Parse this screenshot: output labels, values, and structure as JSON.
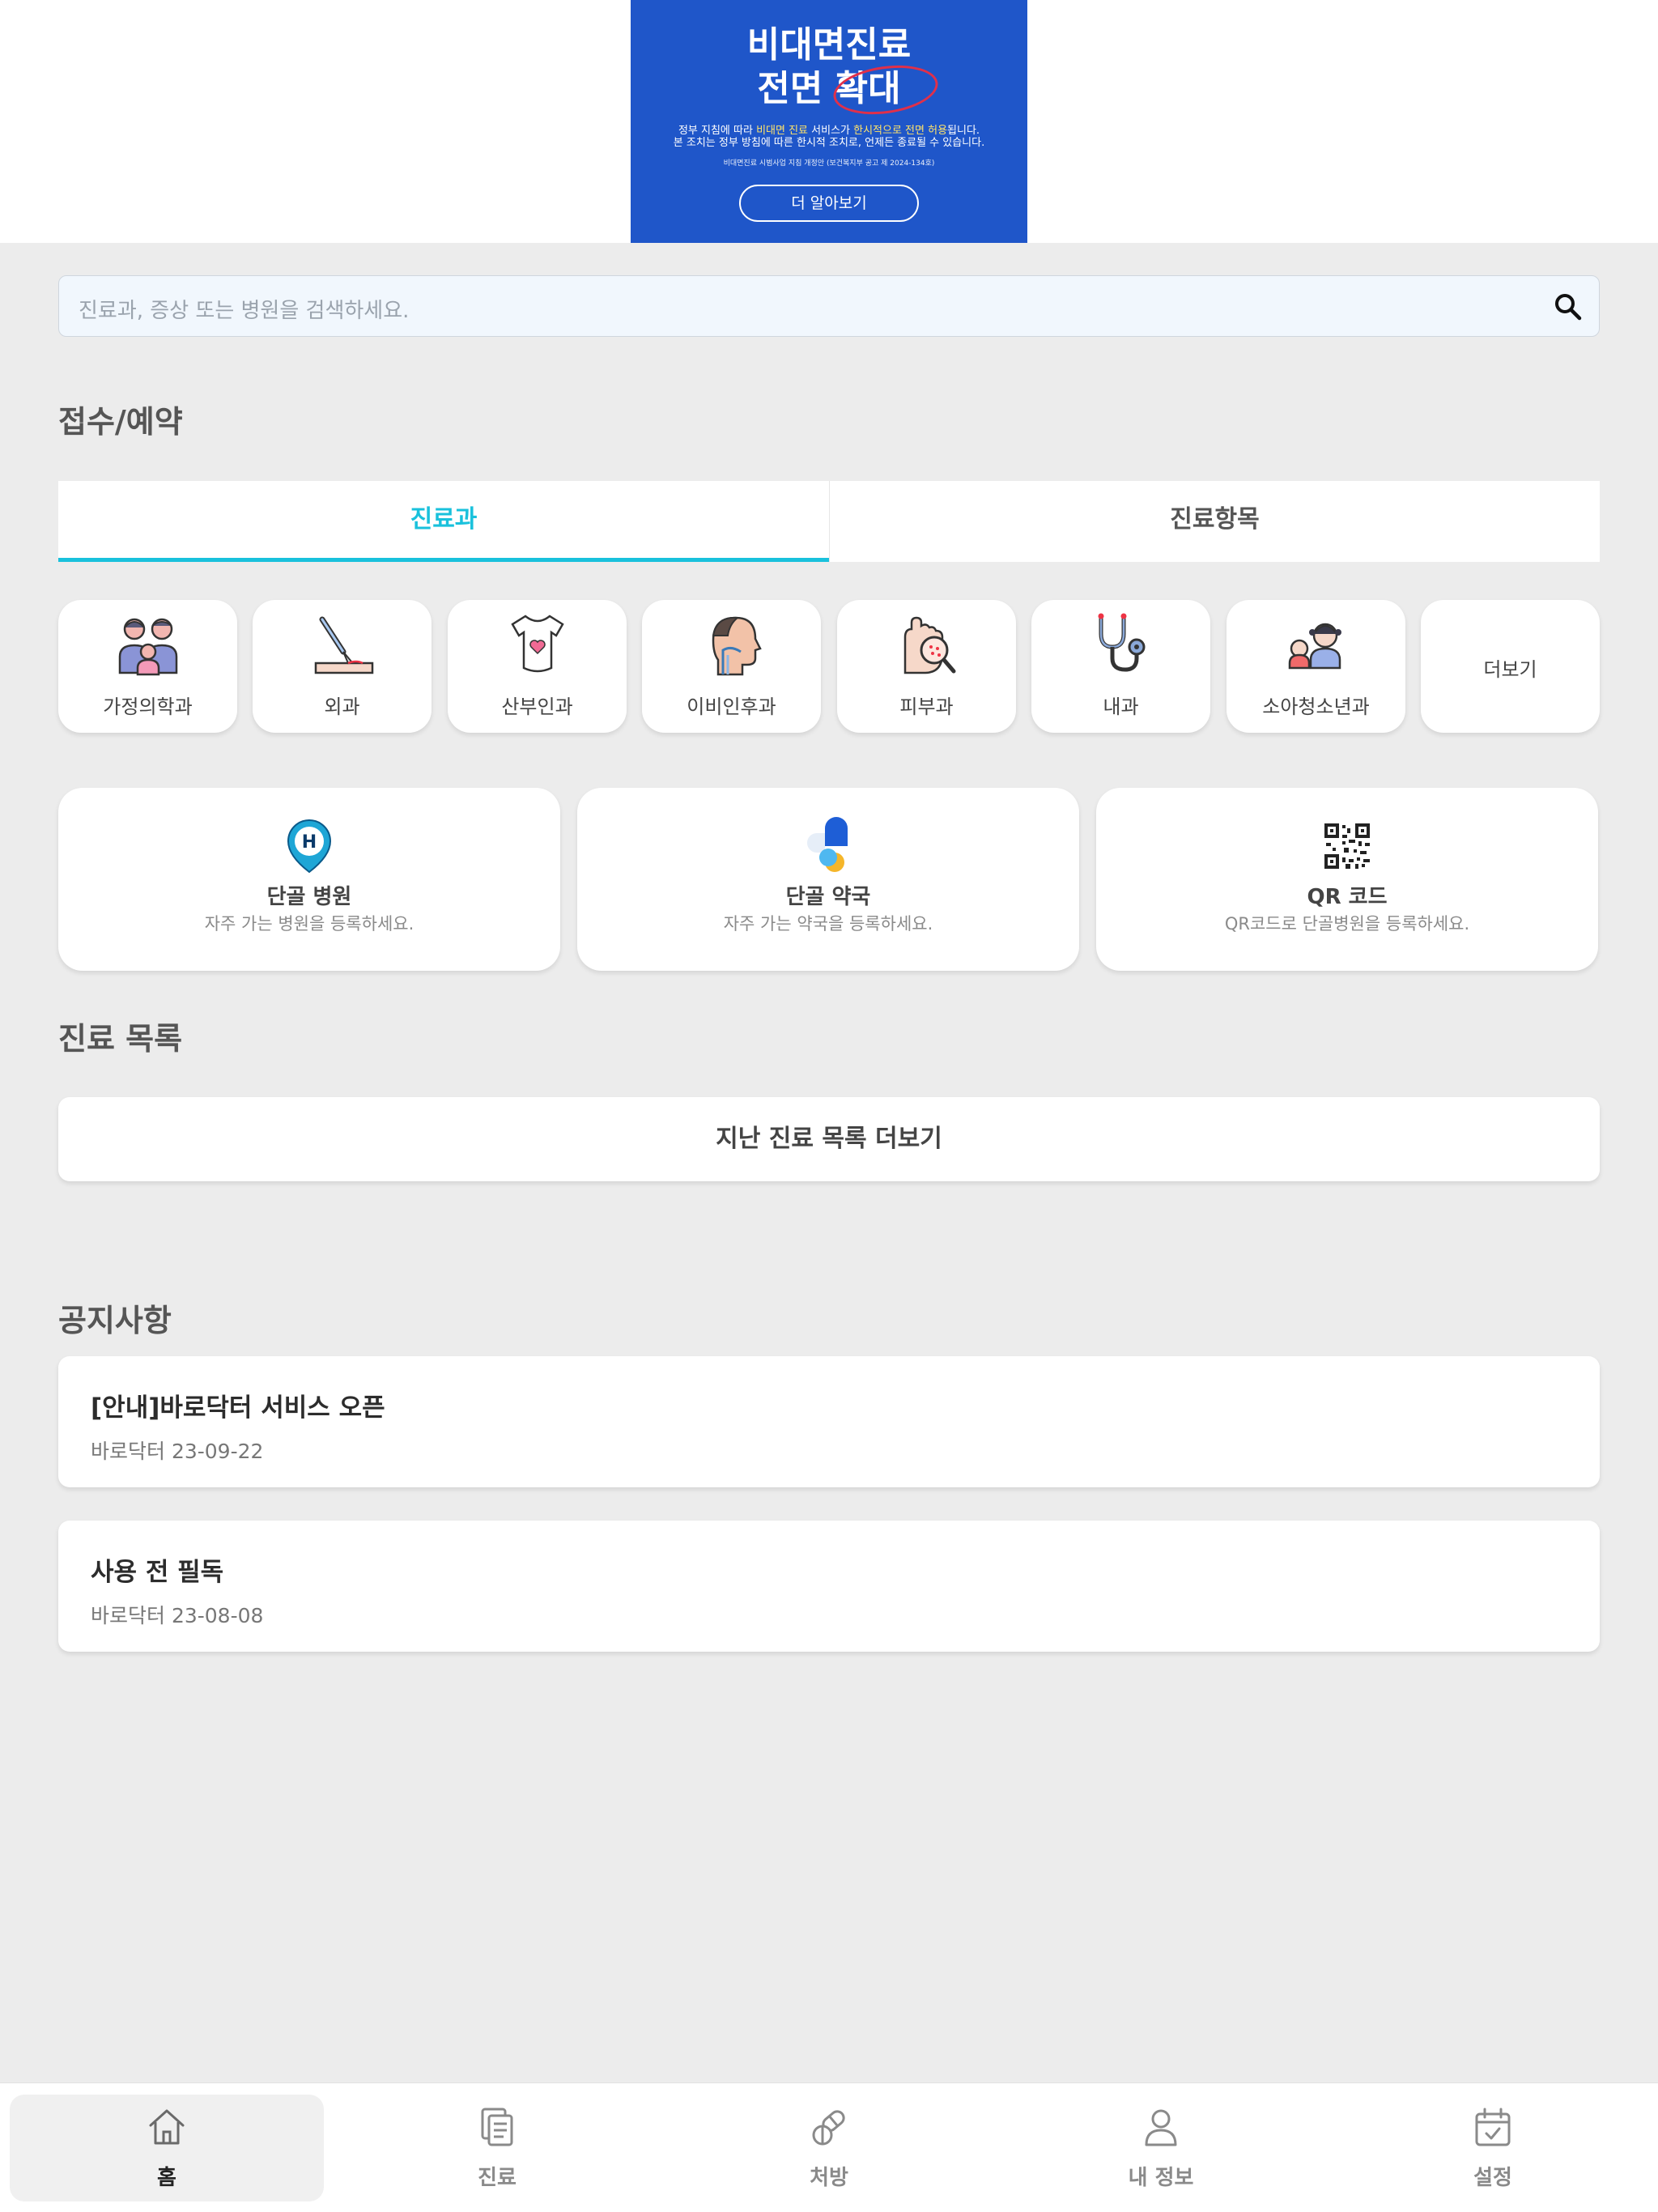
{
  "banner": {
    "title_line1": "비대면진료",
    "title_line2": "전면 확대",
    "desc_line1_a": "정부 지침에 따라 ",
    "desc_line1_hl1": "비대면 진료",
    "desc_line1_b": " 서비스가 ",
    "desc_line1_hl2": "한시적으로 전면 허용",
    "desc_line1_c": "됩니다.",
    "desc_line2": "본 조치는 정부 방침에 따른 한시적 조치로, 언제든 종료될 수 있습니다.",
    "note": "비대면진료 시범사업 지침 개정안 (보건복지부 공고 제 2024-134호)",
    "button": "더 알아보기"
  },
  "search": {
    "placeholder": "진료과, 증상 또는 병원을 검색하세요."
  },
  "reception": {
    "title": "접수/예약",
    "tabs": [
      "진료과",
      "진료항목"
    ],
    "departments": [
      {
        "label": "가정의학과",
        "icon": "family-icon"
      },
      {
        "label": "외과",
        "icon": "scalpel-icon"
      },
      {
        "label": "산부인과",
        "icon": "maternity-dress-icon"
      },
      {
        "label": "이비인후과",
        "icon": "ent-head-icon"
      },
      {
        "label": "피부과",
        "icon": "skin-magnifier-icon"
      },
      {
        "label": "내과",
        "icon": "stethoscope-icon"
      },
      {
        "label": "소아청소년과",
        "icon": "children-icon"
      },
      {
        "label": "더보기",
        "icon": ""
      }
    ],
    "quick": [
      {
        "title": "단골 병원",
        "subtitle": "자주 가는 병원을 등록하세요.",
        "icon": "hospital-pin-icon"
      },
      {
        "title": "단골 약국",
        "subtitle": "자주 가는 약국을 등록하세요.",
        "icon": "pill-icon"
      },
      {
        "title": "QR 코드",
        "subtitle": "QR코드로 단골병원을 등록하세요.",
        "icon": "qr-code-icon"
      }
    ]
  },
  "history": {
    "title": "진료 목록",
    "button": "지난 진료 목록 더보기"
  },
  "notices": {
    "title": "공지사항",
    "items": [
      {
        "title": "[안내]바로닥터 서비스 오픈",
        "meta": "바로닥터 23-09-22"
      },
      {
        "title": "사용 전 필독",
        "meta": "바로닥터 23-08-08"
      }
    ]
  },
  "nav": {
    "items": [
      {
        "label": "홈",
        "icon": "home-icon",
        "active": true
      },
      {
        "label": "진료",
        "icon": "document-icon"
      },
      {
        "label": "처방",
        "icon": "pill-icon"
      },
      {
        "label": "내 정보",
        "icon": "person-icon"
      },
      {
        "label": "설정",
        "icon": "calendar-check-icon"
      }
    ]
  },
  "colors": {
    "accent": "#19c1dc",
    "banner": "#1f56c9",
    "background": "#ececec"
  }
}
